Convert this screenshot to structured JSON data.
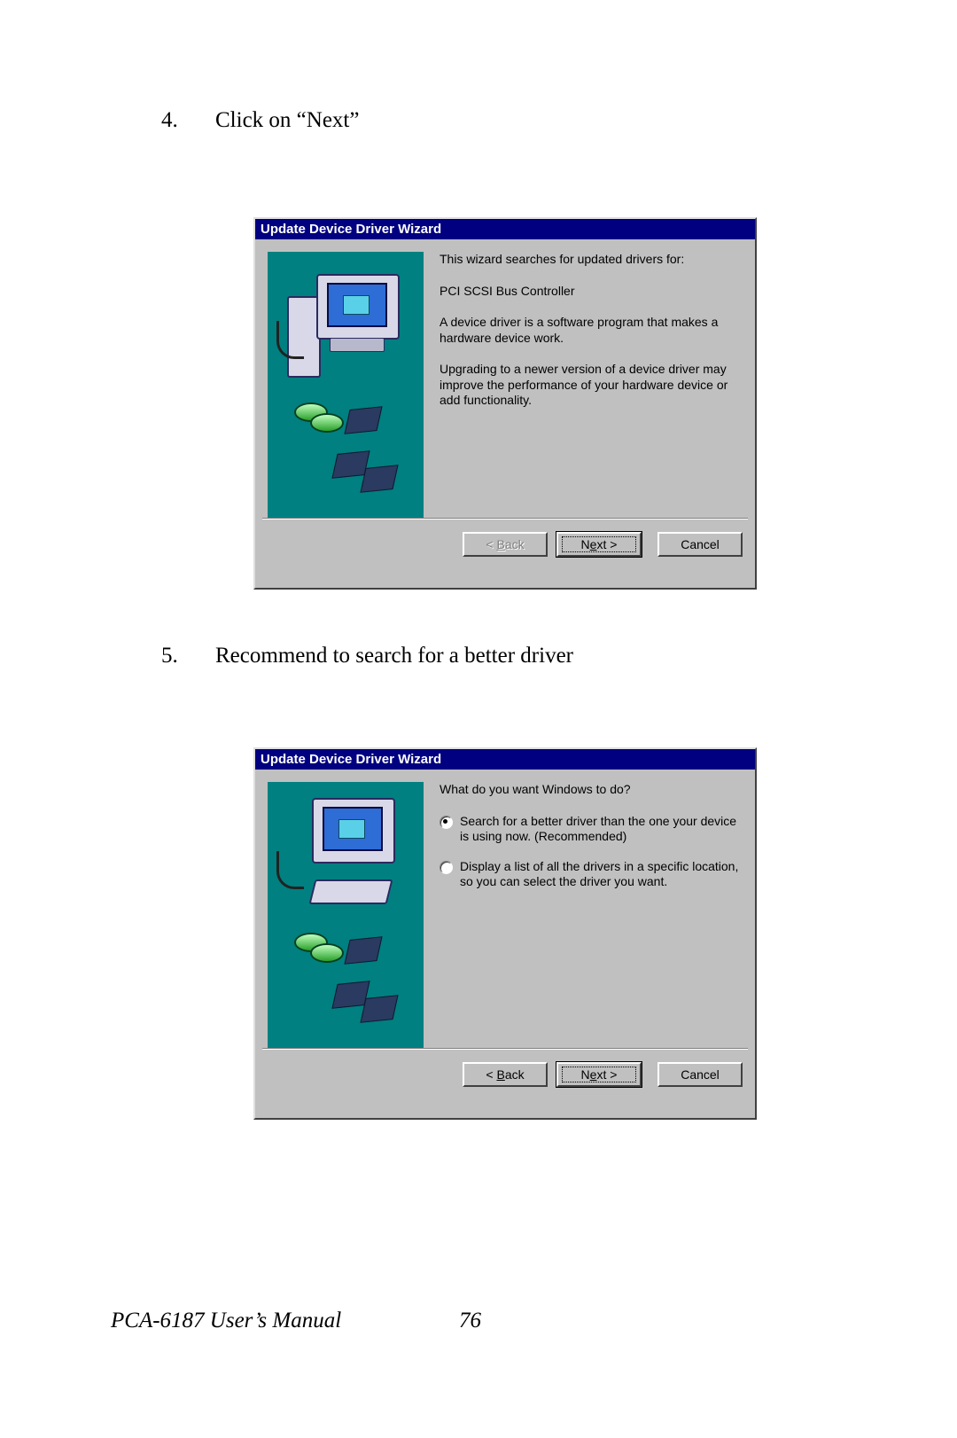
{
  "steps": {
    "s4": {
      "num": "4.",
      "text": "Click on “Next”"
    },
    "s5": {
      "num": "5.",
      "text": "Recommend to search for a better driver"
    }
  },
  "dialog1": {
    "title": "Update Device Driver Wizard",
    "p1": "This wizard searches for updated drivers for:",
    "device": "PCI SCSI Bus Controller",
    "p2": "A device driver is a software program that makes a hardware device work.",
    "p3": "Upgrading to a newer version of a device driver may improve the performance of your hardware device or add functionality.",
    "buttons": {
      "back_prefix": "< ",
      "back_u": "B",
      "back_suffix": "ack",
      "next_prefix": "N",
      "next_u": "e",
      "next_suffix": "xt >",
      "cancel": "Cancel"
    }
  },
  "dialog2": {
    "title": "Update Device Driver Wizard",
    "prompt": "What do you want Windows to do?",
    "opt1": "Search for a better driver than the one your device is using now. (Recommended)",
    "opt2": "Display a list of all the drivers in a specific location, so you can select the driver you want.",
    "buttons": {
      "back_prefix": "< ",
      "back_u": "B",
      "back_suffix": "ack",
      "next_prefix": "N",
      "next_u": "e",
      "next_suffix": "xt >",
      "cancel": "Cancel"
    }
  },
  "footer": {
    "title": "PCA-6187 User’s Manual",
    "page": "76"
  }
}
